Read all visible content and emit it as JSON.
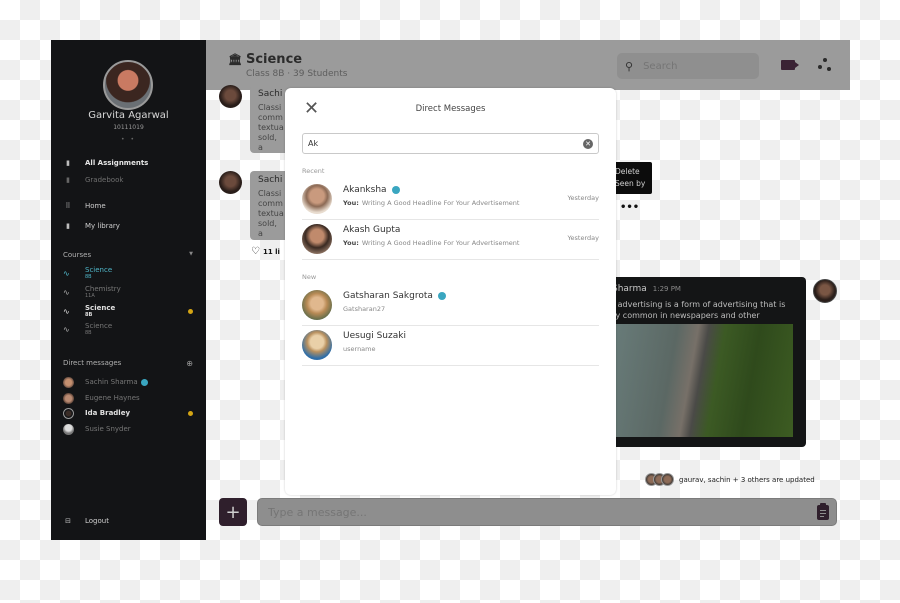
{
  "sidebar": {
    "user": {
      "name": "Garvita Agarwal",
      "id": "10111019",
      "dots": "• •"
    },
    "nav": [
      {
        "label": "All Assignments",
        "icon": "book-icon",
        "state": "active"
      },
      {
        "label": "Gradebook",
        "icon": "book-icon",
        "state": "muted"
      },
      {
        "label": "Home",
        "icon": "grid-icon",
        "state": "normal"
      },
      {
        "label": "My library",
        "icon": "bookmark-icon",
        "state": "normal"
      }
    ],
    "courses_label": "Courses",
    "courses": [
      {
        "name": "Science",
        "class": "8B",
        "state": "selected",
        "unread": false
      },
      {
        "name": "Chemistry",
        "class": "11A",
        "state": "normal",
        "unread": false
      },
      {
        "name": "Science",
        "class": "8B",
        "state": "bold",
        "unread": true
      },
      {
        "name": "Science",
        "class": "8B",
        "state": "normal",
        "unread": false
      }
    ],
    "dm_label": "Direct messages",
    "dms": [
      {
        "name": "Sachin Sharma",
        "verified": true,
        "bold": false,
        "unread": false
      },
      {
        "name": "Eugene Haynes",
        "verified": false,
        "bold": false,
        "unread": false
      },
      {
        "name": "Ida Bradley",
        "verified": false,
        "bold": true,
        "unread": true
      },
      {
        "name": "Susie Snyder",
        "verified": false,
        "bold": false,
        "unread": false
      }
    ],
    "logout_label": "Logout"
  },
  "header": {
    "title": "Science",
    "subtitle": "Class 8B · 39 Students",
    "search_placeholder": "Search"
  },
  "chat": {
    "msg1": {
      "name": "Sachi",
      "lines": [
        "Classi",
        "comm",
        "textua",
        "sold, a"
      ]
    },
    "msg2": {
      "name": "Sachi",
      "lines": [
        "Classi",
        "comm",
        "textua",
        "sold, a"
      ],
      "likes": "11 li"
    },
    "context_menu": [
      "Delete",
      "Seen by"
    ],
    "ellipsis": "•••",
    "dark_msg": {
      "name": "Sharma",
      "time": "1:29 PM",
      "lines": [
        "d advertising is a form of advertising that is",
        "rly common in newspapers and other"
      ]
    },
    "updates_text": "gaurav, sachin + 3 others are updated"
  },
  "composer": {
    "add_label": "+",
    "placeholder": "Type a message..."
  },
  "modal": {
    "title": "Direct Messages",
    "close_label": "✕",
    "search_value": "Ak",
    "recent_label": "Recent",
    "new_label": "New",
    "recent": [
      {
        "name": "Akanksha",
        "verified": true,
        "you_label": "You:",
        "preview": "Writing A Good Headline For Your Advertisement",
        "when": "Yesterday"
      },
      {
        "name": "Akash Gupta",
        "verified": false,
        "you_label": "You:",
        "preview": "Writing A Good Headline For Your Advertisement",
        "when": "Yesterday"
      }
    ],
    "new": [
      {
        "name": "Gatsharan Sakgrota",
        "verified": true,
        "username": "Gatsharan27"
      },
      {
        "name": "Uesugi Suzaki",
        "verified": false,
        "username": "username"
      }
    ]
  }
}
